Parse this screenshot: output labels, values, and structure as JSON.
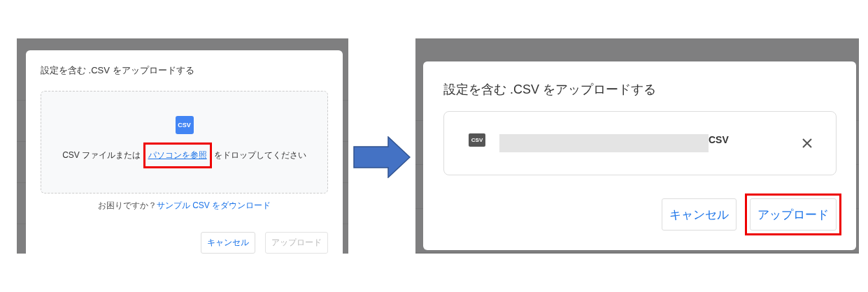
{
  "panels": [
    {
      "kind": "drop",
      "dialog": {
        "title": "設定を含む .CSV をアップロードする",
        "icon_label": "CSV",
        "drop_text_before": "CSV ファイルまたは",
        "link": {
          "label": "パソコンを参照",
          "highlighted": true
        },
        "drop_text_after": "をドロップしてください",
        "help_text": "お困りですか？",
        "help_link": "サンプル CSV をダウンロード",
        "buttons": [
          {
            "label": "キャンセル",
            "disabled": false,
            "highlighted": false
          },
          {
            "label": "アップロード",
            "disabled": true,
            "highlighted": false
          }
        ]
      }
    },
    {
      "kind": "file",
      "dialog": {
        "title": "設定を含む .CSV をアップロードする",
        "file": {
          "icon_label": "CSV",
          "redacted": true,
          "name": "CSV"
        },
        "buttons": [
          {
            "label": "キャンセル",
            "disabled": false,
            "highlighted": false
          },
          {
            "label": "アップロード",
            "disabled": false,
            "highlighted": true
          }
        ]
      }
    }
  ]
}
